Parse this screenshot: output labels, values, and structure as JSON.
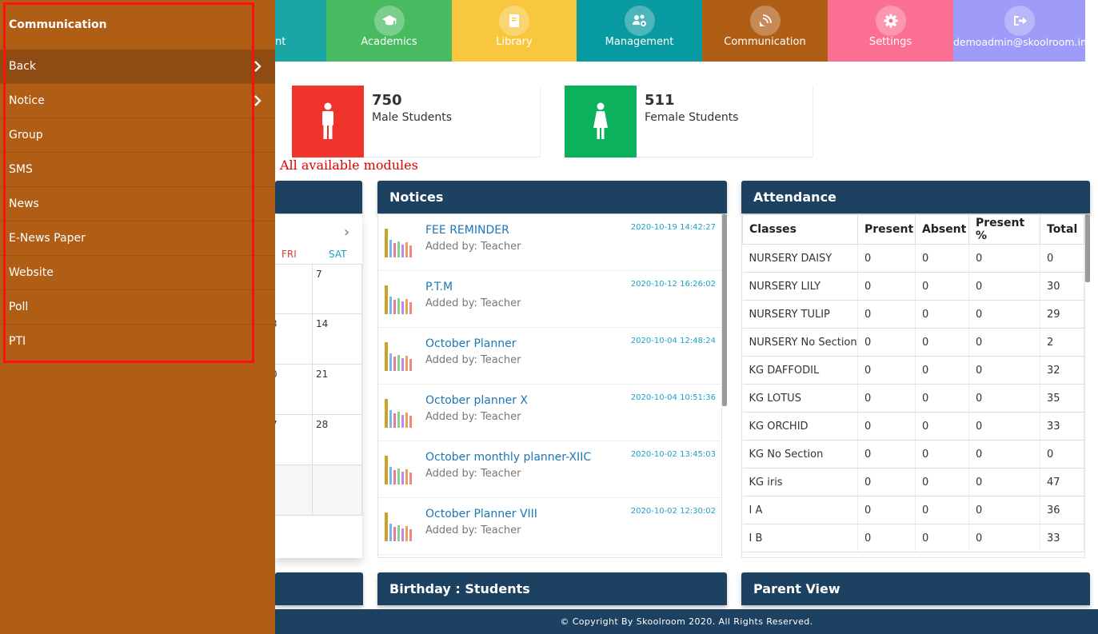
{
  "colors": {
    "sidebar_bg": "#b05e16",
    "sidebar_active": "#8f4c12",
    "panel_header": "#1d4160",
    "red_annotation": "#ff1010",
    "male_tile": "#f0342c",
    "female_tile": "#0bb15c"
  },
  "topnav": {
    "tiles": [
      {
        "label": "nt",
        "color": "#1ba6a6",
        "icon": "student-icon"
      },
      {
        "label": "Academics",
        "color": "#48bb61",
        "icon": "graduation-cap-icon"
      },
      {
        "label": "Library",
        "color": "#f8c73e",
        "icon": "book-icon"
      },
      {
        "label": "Management",
        "color": "#079aa0",
        "icon": "users-cog-icon"
      },
      {
        "label": "Communication",
        "color": "#b05e16",
        "icon": "satellite-dish-icon"
      },
      {
        "label": "Settings",
        "color": "#fb6f92",
        "icon": "gear-icon"
      },
      {
        "label": "demoadmin@skoolroom.in",
        "color": "#9f9bf8",
        "icon": "sign-out-icon"
      }
    ]
  },
  "stats": {
    "male": {
      "count": "750",
      "label": "Male Students",
      "icon": "male-icon"
    },
    "female": {
      "count": "511",
      "label": "Female Students",
      "icon": "female-icon"
    }
  },
  "annotation": "All available modules",
  "calendar": {
    "days": [
      "FRI",
      "SAT"
    ],
    "cells": [
      [
        "",
        "7"
      ],
      [
        "3",
        "14"
      ],
      [
        "0",
        "21"
      ],
      [
        "7",
        "28"
      ],
      [
        "",
        ""
      ]
    ]
  },
  "notices": {
    "title": "Notices",
    "items": [
      {
        "title": "FEE REMINDER",
        "by": "Added by: Teacher",
        "date": "2020-10-19 14:42:27"
      },
      {
        "title": "P.T.M",
        "by": "Added by: Teacher",
        "date": "2020-10-12 16:26:02"
      },
      {
        "title": "October Planner",
        "by": "Added by: Teacher",
        "date": "2020-10-04 12:48:24"
      },
      {
        "title": "October planner X",
        "by": "Added by: Teacher",
        "date": "2020-10-04 10:51:36"
      },
      {
        "title": "October monthly planner-XIIC",
        "by": "Added by: Teacher",
        "date": "2020-10-02 13:45:03"
      },
      {
        "title": "October Planner VIII",
        "by": "Added by: Teacher",
        "date": "2020-10-02 12:30:02"
      }
    ]
  },
  "attendance": {
    "title": "Attendance",
    "columns": [
      "Classes",
      "Present",
      "Absent",
      "Present %",
      "Total"
    ],
    "rows": [
      [
        "NURSERY DAISY",
        "0",
        "0",
        "0",
        "0"
      ],
      [
        "NURSERY LILY",
        "0",
        "0",
        "0",
        "30"
      ],
      [
        "NURSERY TULIP",
        "0",
        "0",
        "0",
        "29"
      ],
      [
        "NURSERY No Section",
        "0",
        "0",
        "0",
        "2"
      ],
      [
        "KG DAFFODIL",
        "0",
        "0",
        "0",
        "32"
      ],
      [
        "KG LOTUS",
        "0",
        "0",
        "0",
        "35"
      ],
      [
        "KG ORCHID",
        "0",
        "0",
        "0",
        "33"
      ],
      [
        "KG No Section",
        "0",
        "0",
        "0",
        "0"
      ],
      [
        "KG iris",
        "0",
        "0",
        "0",
        "47"
      ],
      [
        "I A",
        "0",
        "0",
        "0",
        "36"
      ],
      [
        "I B",
        "0",
        "0",
        "0",
        "33"
      ]
    ]
  },
  "bottom_panels": {
    "birthday": "Birthday : Students",
    "parent": "Parent View"
  },
  "sidebar": {
    "title": "Communication",
    "items": [
      {
        "label": "Back",
        "chevron": true,
        "active": true
      },
      {
        "label": "Notice",
        "chevron": true,
        "active": false
      },
      {
        "label": "Group",
        "chevron": false,
        "active": false
      },
      {
        "label": "SMS",
        "chevron": false,
        "active": false
      },
      {
        "label": "News",
        "chevron": false,
        "active": false
      },
      {
        "label": "E-News Paper",
        "chevron": false,
        "active": false
      },
      {
        "label": "Website",
        "chevron": false,
        "active": false
      },
      {
        "label": "Poll",
        "chevron": false,
        "active": false
      },
      {
        "label": "PTI",
        "chevron": false,
        "active": false
      }
    ]
  },
  "footer": "© Copyright By Skoolroom 2020. All Rights Reserved."
}
